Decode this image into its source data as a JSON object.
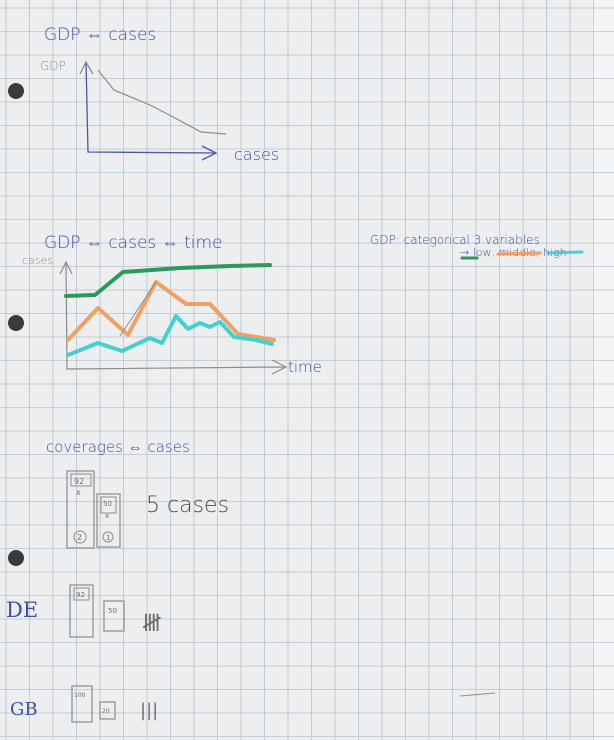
{
  "notebook": {
    "paper_color": "#eceeef",
    "grid_color": "#b7c3ce",
    "ink_color": "#3f4fa3",
    "pencil_color": "#8c8c8c"
  },
  "sketch1": {
    "title": "GDP ⇔ cases",
    "y_label": "GDP",
    "x_label": "cases"
  },
  "sketch2": {
    "title": "GDP ⇔ cases ⇔ time",
    "y_label": "cases",
    "x_label": "time",
    "series_colors": [
      "#2a9a5a",
      "#f0a060",
      "#45d0d0"
    ],
    "note_line1": "GDP: categorical 3 variables",
    "note_line2": "→ low, middle, high"
  },
  "sketch3": {
    "title": "coverages ⇔ cases",
    "bar1_value": "92",
    "bar1_mark": "x",
    "bar1_circle": "2",
    "bar2_value": "50",
    "bar2_mark": "x",
    "bar2_circle": "1",
    "label": "5 cases"
  },
  "rows": [
    {
      "country": "DE",
      "bar1": "92",
      "bar2": "50",
      "tally": "𝍸"
    },
    {
      "country": "GB",
      "bar1": "100",
      "bar2": "20",
      "tally": "|||"
    }
  ]
}
